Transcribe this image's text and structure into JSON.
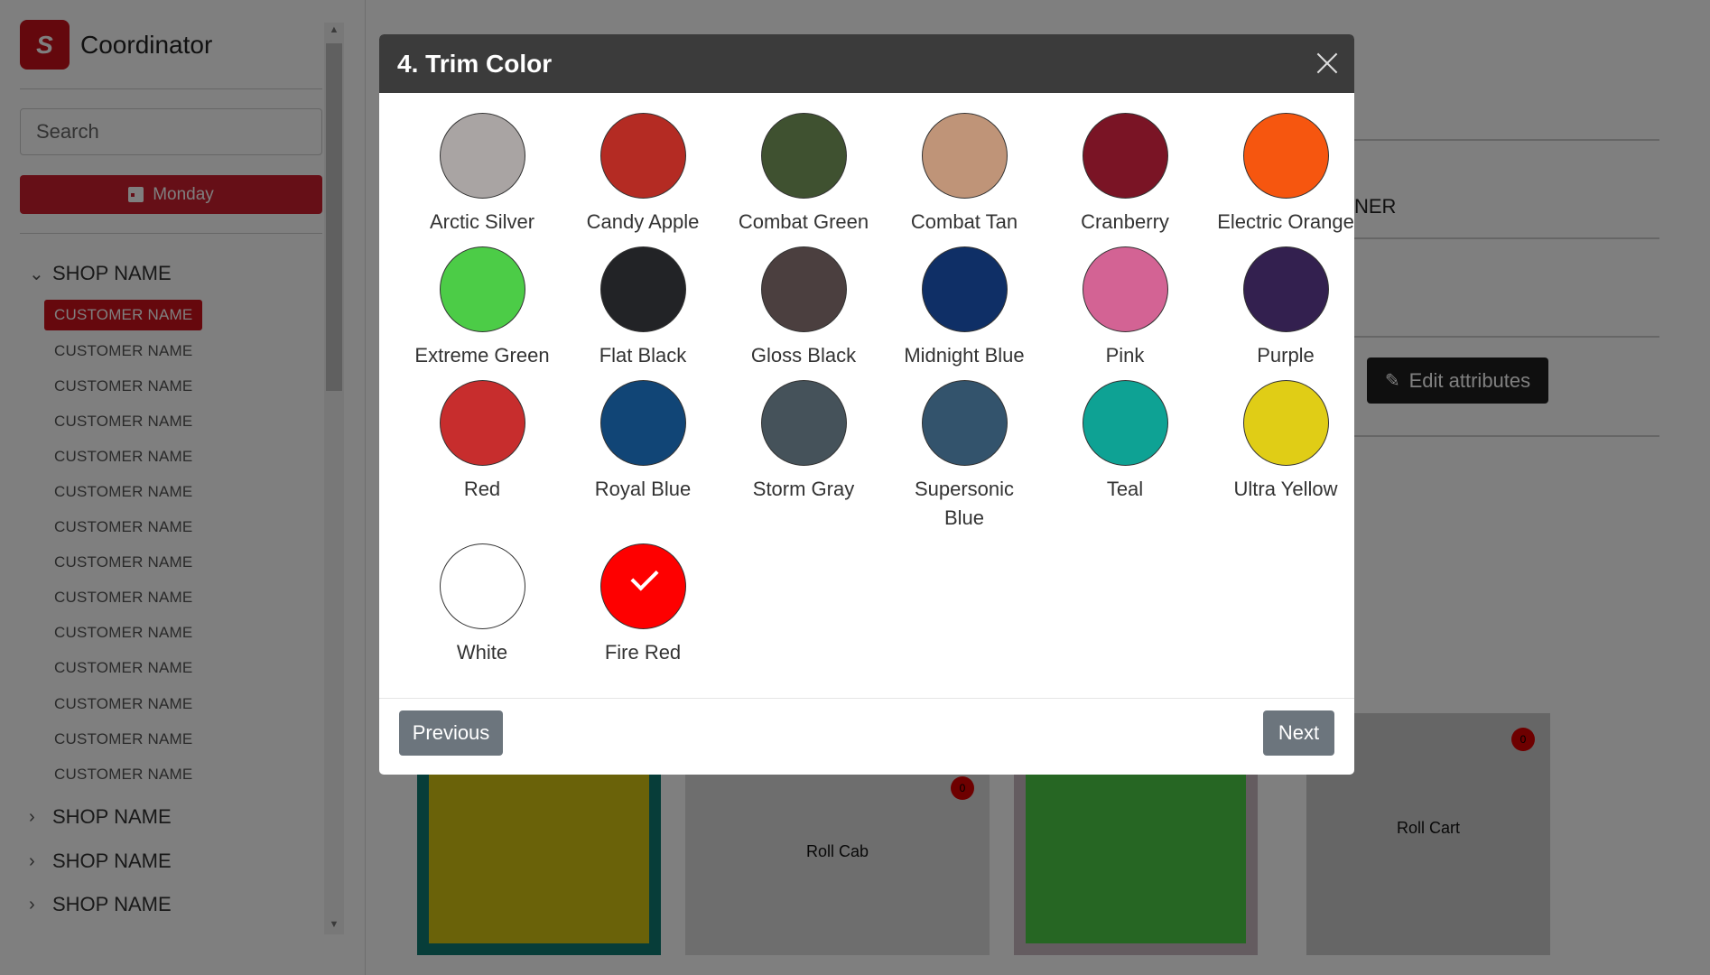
{
  "sidebar": {
    "brand": {
      "logo_letter": "S",
      "title": "Coordinator",
      "logo_color": "#c8101a"
    },
    "search": {
      "placeholder": "Search"
    },
    "day_button": {
      "label": "Monday",
      "icon": "calendar-icon"
    },
    "shops": [
      {
        "label": "SHOP NAME",
        "expanded": true
      },
      {
        "label": "SHOP NAME",
        "expanded": false
      },
      {
        "label": "SHOP NAME",
        "expanded": false
      },
      {
        "label": "SHOP NAME",
        "expanded": false
      }
    ],
    "customers": [
      "CUSTOMER NAME",
      "CUSTOMER NAME",
      "CUSTOMER NAME",
      "CUSTOMER NAME",
      "CUSTOMER NAME",
      "CUSTOMER NAME",
      "CUSTOMER NAME",
      "CUSTOMER NAME",
      "CUSTOMER NAME",
      "CUSTOMER NAME",
      "CUSTOMER NAME",
      "CUSTOMER NAME",
      "CUSTOMER NAME",
      "CUSTOMER NAME"
    ],
    "active_customer_index": 0
  },
  "main": {
    "partial_text": "NER",
    "edit_button": {
      "label": "Edit attributes",
      "icon": "pencil-icon"
    },
    "tiles": [
      {
        "label": "",
        "color": "#d4c412",
        "border": "#0e7a73"
      },
      {
        "label": "Roll Cab",
        "badge": "0",
        "color": "#dddddd"
      },
      {
        "label": "",
        "color": "#4ccc47",
        "border": "#c8b8c0"
      },
      {
        "label": "Roll Cart",
        "badge": "0",
        "color": "#cccccc"
      }
    ]
  },
  "modal": {
    "title": "4. Trim Color",
    "close_icon": "close-icon",
    "swatches": [
      {
        "name": "Arctic Silver",
        "color": "#a9a4a3"
      },
      {
        "name": "Candy Apple",
        "color": "#b42b23"
      },
      {
        "name": "Combat Green",
        "color": "#3f5130"
      },
      {
        "name": "Combat Tan",
        "color": "#bf9478"
      },
      {
        "name": "Cranberry",
        "color": "#7a1425"
      },
      {
        "name": "Electric Orange",
        "color": "#f6560f"
      },
      {
        "name": "Extreme Green",
        "color": "#4ccc47"
      },
      {
        "name": "Flat Black",
        "color": "#222326"
      },
      {
        "name": "Gloss Black",
        "color": "#4b3f3f"
      },
      {
        "name": "Midnight Blue",
        "color": "#0f2f66"
      },
      {
        "name": "Pink",
        "color": "#d36394"
      },
      {
        "name": "Purple",
        "color": "#33204f"
      },
      {
        "name": "Red",
        "color": "#c72d2d"
      },
      {
        "name": "Royal Blue",
        "color": "#114576"
      },
      {
        "name": "Storm Gray",
        "color": "#45525a"
      },
      {
        "name": "Supersonic Blue",
        "color": "#33536c"
      },
      {
        "name": "Teal",
        "color": "#0ea294"
      },
      {
        "name": "Ultra Yellow",
        "color": "#e0cd16"
      },
      {
        "name": "White",
        "color": "#ffffff"
      },
      {
        "name": "Fire Red",
        "color": "#fe0000",
        "selected": true
      }
    ],
    "previous_label": "Previous",
    "next_label": "Next"
  }
}
